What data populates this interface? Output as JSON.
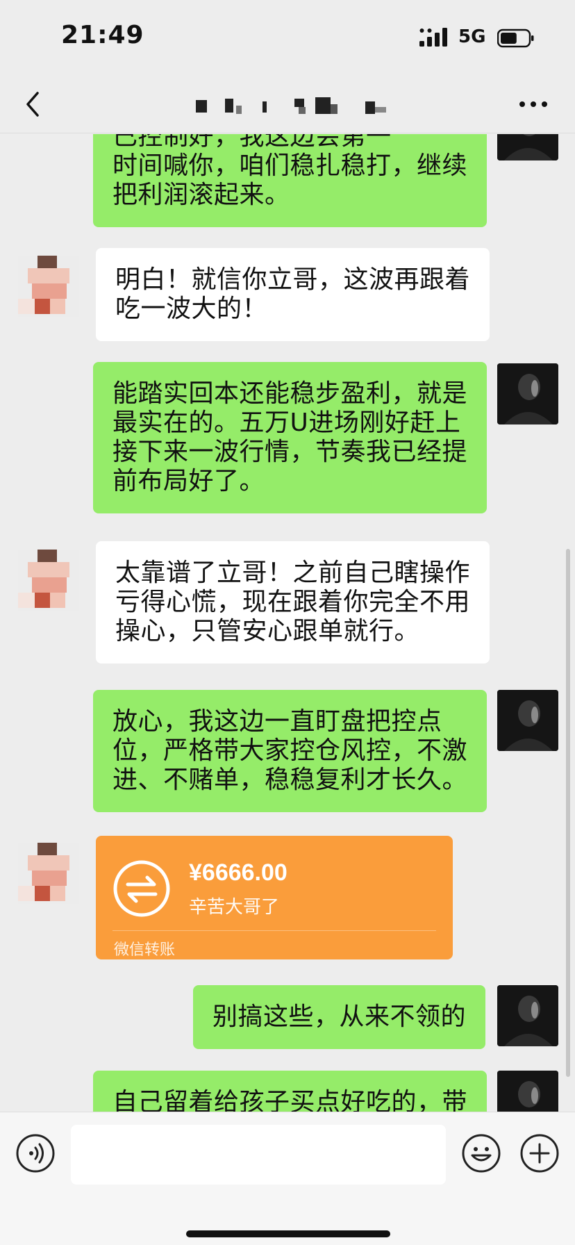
{
  "status_bar": {
    "time": "21:49",
    "network": "5G",
    "signal_icon": "signal-bars-icon",
    "battery_icon": "battery-icon",
    "battery_level": 0.6
  },
  "nav": {
    "back_icon": "chevron-left-icon",
    "more_icon": "more-dots-icon",
    "title_obscured": true
  },
  "colors": {
    "background": "#ededed",
    "my_bubble": "#95ec69",
    "their_bubble": "#ffffff",
    "transfer": "#fa9d3b"
  },
  "messages": [
    {
      "from": "me",
      "lines": [
        "已控制好，我这边会第一",
        "时间喊你，咱们稳扎稳打，继续",
        "把利润滚起来。"
      ]
    },
    {
      "from": "them",
      "lines": [
        "明白！就信你立哥，这波再跟着",
        "吃一波大的！"
      ]
    },
    {
      "from": "me",
      "lines": [
        "能踏实回本还能稳步盈利，就是",
        "最实在的。五万U进场刚好赶上",
        "接下来一波行情，节奏我已经提",
        "前布局好了。"
      ]
    },
    {
      "from": "them",
      "lines": [
        "太靠谱了立哥！之前自己瞎操作",
        "亏得心慌，现在跟着你完全不用",
        "操心，只管安心跟单就行。"
      ]
    },
    {
      "from": "me",
      "lines": [
        "放心，我这边一直盯盘把控点",
        "位，严格带大家控仓风控，不激",
        "进、不赌单，稳稳复利才长久。"
      ]
    },
    {
      "from": "them",
      "type": "transfer",
      "amount": "¥6666.00",
      "note": "辛苦大哥了",
      "label": "微信转账",
      "icon": "transfer-arrows-icon"
    },
    {
      "from": "me",
      "lines": [
        "别搞这些，从来不领的"
      ]
    },
    {
      "from": "me",
      "lines": [
        "自己留着给孩子买点好吃的，带"
      ]
    }
  ],
  "input_bar": {
    "voice_icon": "voice-icon",
    "emoji_icon": "emoji-icon",
    "plus_icon": "plus-icon",
    "text_value": ""
  }
}
